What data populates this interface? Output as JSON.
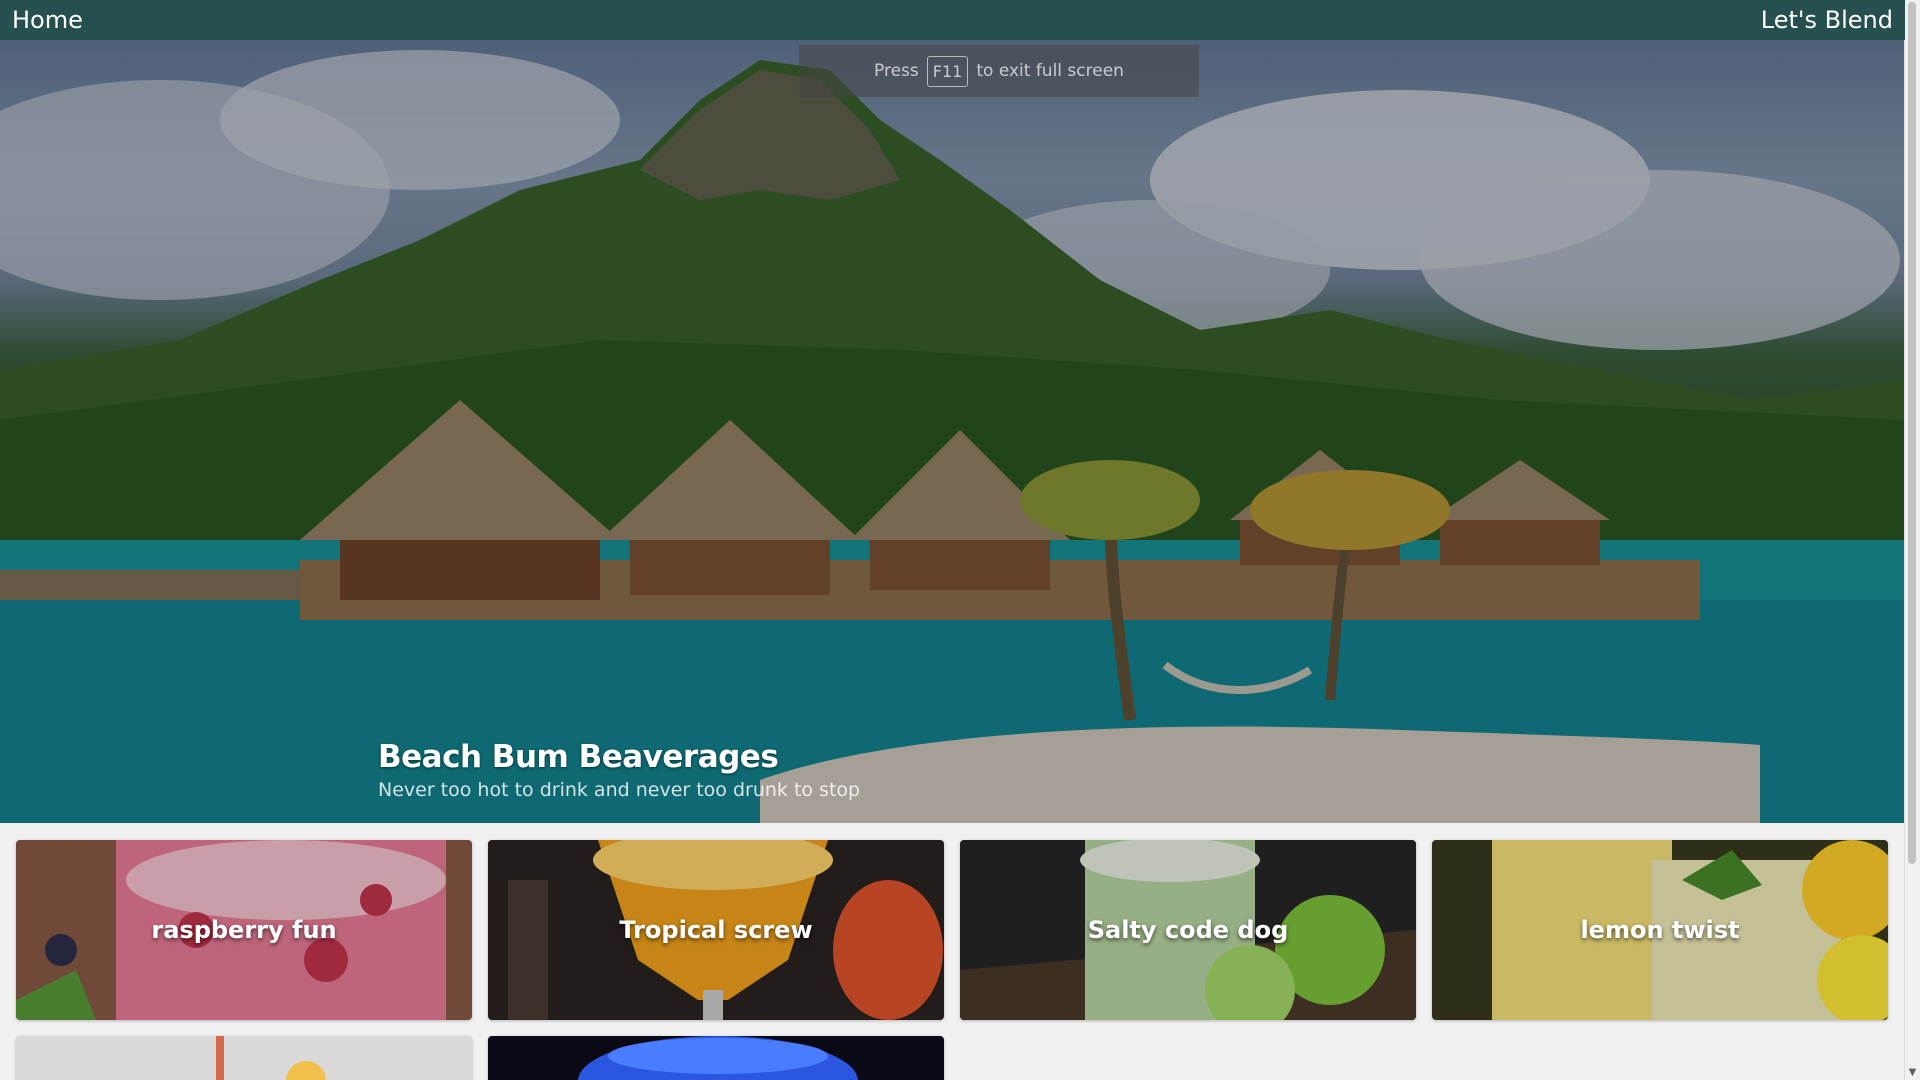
{
  "navbar": {
    "home_label": "Home",
    "blend_label": "Let's Blend",
    "background": "#264f50"
  },
  "fullscreen_notice": {
    "prefix": "Press",
    "key": "F11",
    "suffix": "to exit full screen"
  },
  "hero": {
    "title": "Beach Bum Beaverages",
    "subtitle": "Never too hot to drink and never too drunk to stop"
  },
  "drinks": [
    {
      "name": "raspberry fun",
      "image": "raspberry-drink",
      "colors": [
        "#c2324b",
        "#e97c97",
        "#f4c3cd"
      ]
    },
    {
      "name": "Tropical screw",
      "image": "tropical-drink",
      "colors": [
        "#2a2320",
        "#f2a31c",
        "#ffd36b"
      ]
    },
    {
      "name": "Salty code dog",
      "image": "margarita-drink",
      "colors": [
        "#262626",
        "#b9d6a3",
        "#7dc33a"
      ]
    },
    {
      "name": "lemon twist",
      "image": "lemon-drink",
      "colors": [
        "#3a3a1f",
        "#f6e27a",
        "#ffe93b"
      ]
    },
    {
      "name": "",
      "image": "citrus-drink",
      "colors": [
        "#d9d9d9",
        "#f0c04a",
        "#ffffff"
      ]
    },
    {
      "name": "",
      "image": "blue-drink",
      "colors": [
        "#0a0a14",
        "#2b56e0",
        "#4a7cff"
      ]
    }
  ],
  "icons": {
    "scroll_down": "scroll-down-arrow-icon"
  }
}
